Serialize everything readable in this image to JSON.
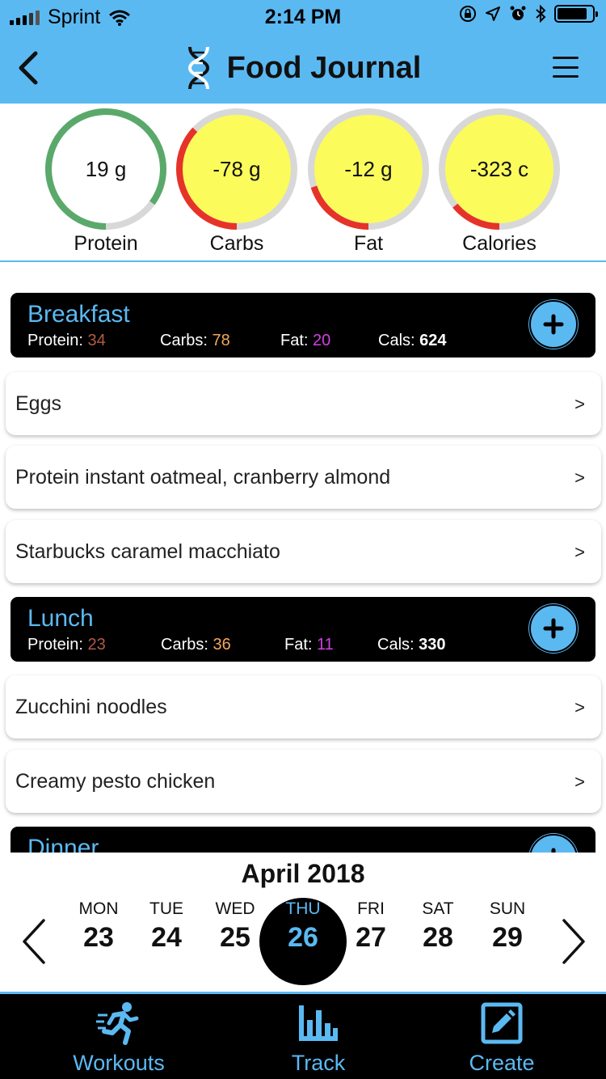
{
  "status_bar": {
    "carrier": "Sprint",
    "time": "2:14 PM",
    "battery_level": 0.85
  },
  "header": {
    "title": "Food Journal"
  },
  "summary": {
    "rings": [
      {
        "label": "Protein",
        "value": "19 g",
        "progress": 0.85,
        "fill_color": "#ffffff",
        "arc_color": "#5aa96b"
      },
      {
        "label": "Carbs",
        "value": "-78 g",
        "progress": 0.37,
        "fill_color": "#fbfb5c",
        "arc_color": "#e63329"
      },
      {
        "label": "Fat",
        "value": "-12 g",
        "progress": 0.2,
        "fill_color": "#fbfb5c",
        "arc_color": "#e63329"
      },
      {
        "label": "Calories",
        "value": "-323 c",
        "progress": 0.14,
        "fill_color": "#fbfb5c",
        "arc_color": "#e63329"
      }
    ]
  },
  "meals": [
    {
      "title": "Breakfast",
      "protein_label": "Protein:",
      "protein": "34",
      "carbs_label": "Carbs:",
      "carbs": "78",
      "fat_label": "Fat:",
      "fat": "20",
      "cals_label": "Cals:",
      "cals": "624",
      "items": [
        {
          "name": "Eggs"
        },
        {
          "name": "Protein instant oatmeal, cranberry almond"
        },
        {
          "name": "Starbucks caramel macchiato"
        }
      ]
    },
    {
      "title": "Lunch",
      "protein_label": "Protein:",
      "protein": "23",
      "carbs_label": "Carbs:",
      "carbs": "36",
      "fat_label": "Fat:",
      "fat": "11",
      "cals_label": "Cals:",
      "cals": "330",
      "items": [
        {
          "name": "Zucchini noodles"
        },
        {
          "name": "Creamy pesto chicken"
        }
      ]
    },
    {
      "title": "Dinner"
    }
  ],
  "chevron": ">",
  "calendar": {
    "month": "April 2018",
    "days": [
      {
        "name": "MON",
        "num": "23"
      },
      {
        "name": "TUE",
        "num": "24"
      },
      {
        "name": "WED",
        "num": "25"
      },
      {
        "name": "THU",
        "num": "26",
        "selected": true
      },
      {
        "name": "FRI",
        "num": "27"
      },
      {
        "name": "SAT",
        "num": "28"
      },
      {
        "name": "SUN",
        "num": "29"
      }
    ]
  },
  "tabbar": {
    "tabs": [
      {
        "label": "Workouts",
        "icon": "running-person-icon"
      },
      {
        "label": "Track",
        "icon": "bar-chart-icon"
      },
      {
        "label": "Create",
        "icon": "edit-square-icon"
      }
    ]
  },
  "colors": {
    "accent": "#5bb9f2",
    "ring_track": "#d8d8d8"
  }
}
